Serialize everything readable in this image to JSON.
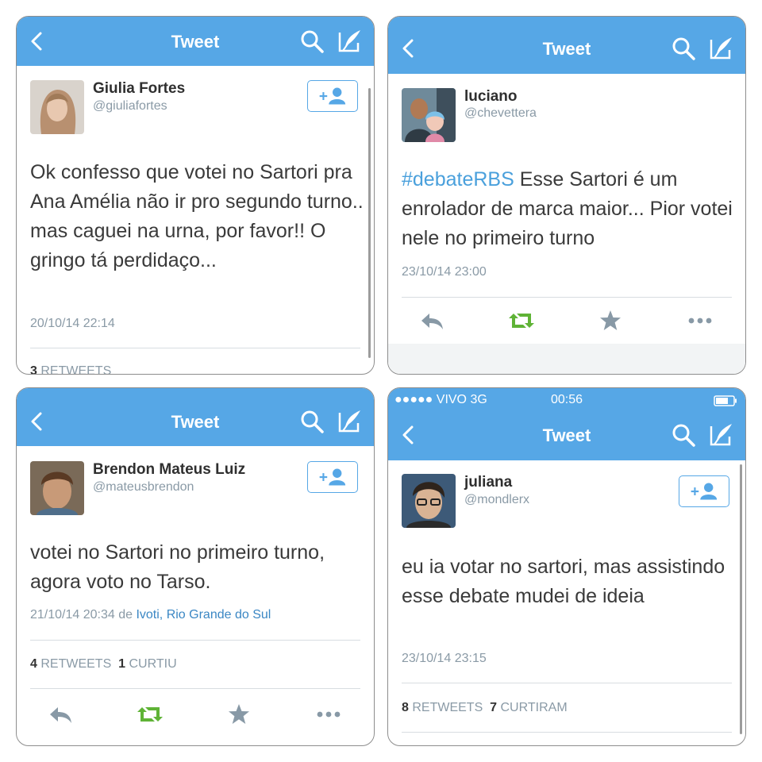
{
  "colors": {
    "nav": "#56a7e6",
    "retweet": "#5fb336",
    "link": "#3b87c4"
  },
  "panels": [
    {
      "nav_title": "Tweet",
      "name": "Giulia Fortes",
      "handle": "@giuliafortes",
      "text": "Ok confesso que votei no Sartori pra Ana Amélia não ir pro segundo turno.. mas caguei na urna, por favor!! O gringo tá perdidaço...",
      "timestamp": "20/10/14 22:14",
      "retweets_count": "3",
      "retweets_label": "RETWEETS"
    },
    {
      "nav_title": "Tweet",
      "name": "luciano",
      "handle": "@chevettera",
      "hashtag": "#debateRBS",
      "text": " Esse Sartori é um enrolador de marca maior... Pior votei nele no primeiro turno",
      "timestamp": "23/10/14 23:00"
    },
    {
      "nav_title": "Tweet",
      "status_carrier": "●●●●● VIVO  3G",
      "status_time": "00:56",
      "name": "Brendon Mateus Luiz",
      "handle": "@mateusbrendon",
      "text": "votei no Sartori no primeiro turno, agora voto no Tarso.",
      "timestamp": "21/10/14 20:34",
      "location_prefix": " de ",
      "location": "Ivoti, Rio Grande do Sul",
      "retweets_count": "4",
      "retweets_label": "RETWEETS",
      "likes_count": "1",
      "likes_label": "CURTIU"
    },
    {
      "nav_title": "Tweet",
      "status_carrier": "●●●●● VIVO  3G",
      "status_time": "00:56",
      "name": "juliana",
      "handle": "@mondlerx",
      "text": "eu ia votar no sartori, mas assistindo esse debate mudei de ideia",
      "timestamp": "23/10/14 23:15",
      "retweets_count": "8",
      "retweets_label": "RETWEETS",
      "likes_count": "7",
      "likes_label": "CURTIRAM"
    }
  ],
  "icons": {
    "back": "chevron-left-icon",
    "search": "search-icon",
    "compose": "compose-icon",
    "follow": "add-user-icon",
    "reply": "reply-icon",
    "retweet": "retweet-icon",
    "favorite": "star-icon",
    "more": "more-icon"
  }
}
